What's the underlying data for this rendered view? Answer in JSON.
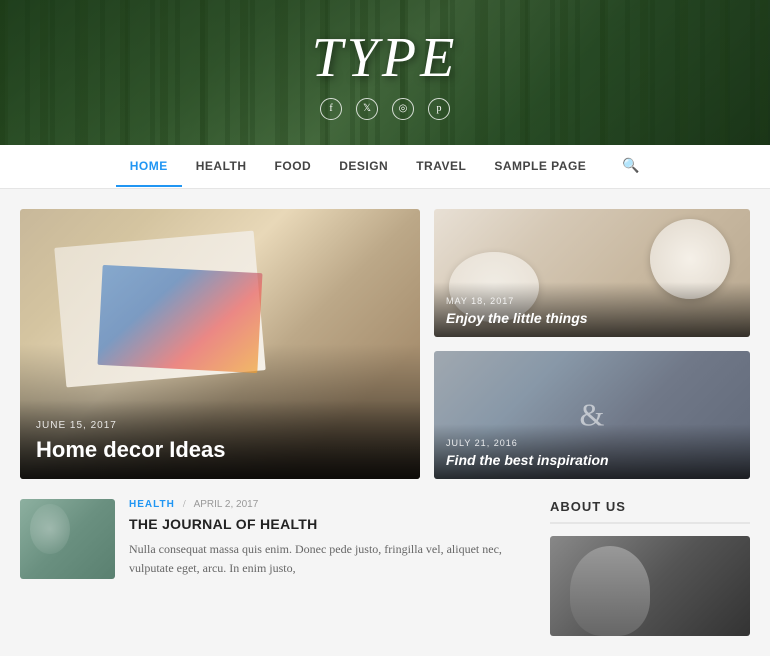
{
  "header": {
    "title": "TYPE",
    "social": [
      {
        "name": "facebook",
        "symbol": "f"
      },
      {
        "name": "twitter",
        "symbol": "t"
      },
      {
        "name": "instagram",
        "symbol": "i"
      },
      {
        "name": "pinterest",
        "symbol": "p"
      }
    ]
  },
  "nav": {
    "items": [
      {
        "label": "HOME",
        "active": true
      },
      {
        "label": "HEALTH",
        "active": false
      },
      {
        "label": "FOOD",
        "active": false
      },
      {
        "label": "DESIGN",
        "active": false
      },
      {
        "label": "TRAVEL",
        "active": false
      },
      {
        "label": "SAMPLE PAGE",
        "active": false
      }
    ],
    "search_label": "🔍"
  },
  "featured": {
    "date": "JUNE 15, 2017",
    "title": "Home decor Ideas"
  },
  "sidebar_cards": [
    {
      "date": "MAY 18, 2017",
      "title": "Enjoy the little things"
    },
    {
      "date": "JULY 21, 2016",
      "title": "Find the best inspiration"
    }
  ],
  "posts": [
    {
      "category": "HEALTH",
      "date": "APRIL 2, 2017",
      "title": "THE JOURNAL OF HEALTH",
      "excerpt": "Nulla consequat massa quis enim. Donec pede justo, fringilla vel, aliquet nec, vulputate eget, arcu. In enim justo,"
    }
  ],
  "about": {
    "title": "ABOUT US"
  },
  "ampersand": "&"
}
